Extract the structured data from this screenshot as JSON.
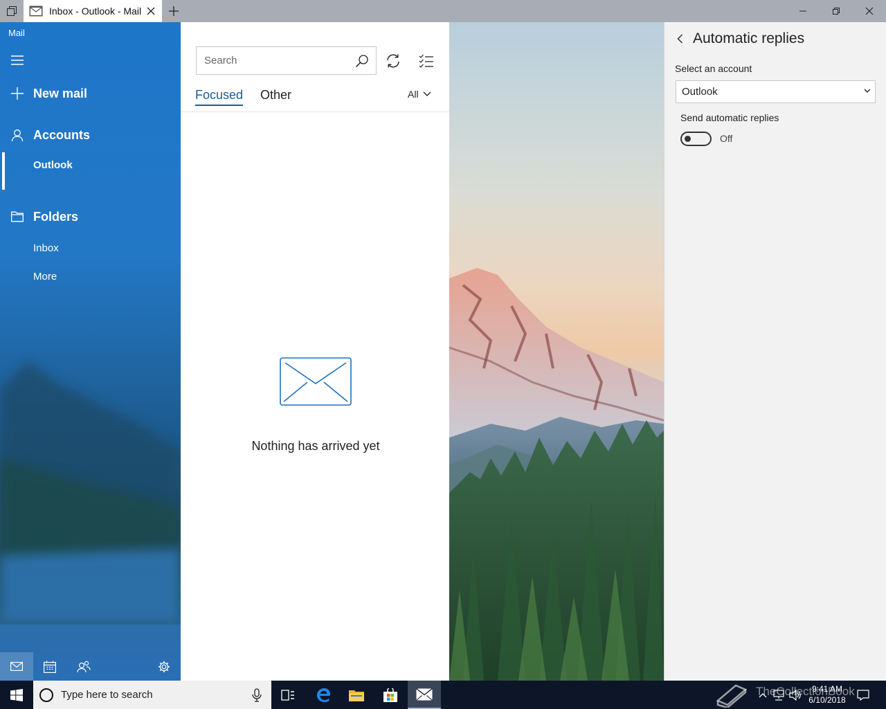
{
  "titlebar": {
    "tab_title": "Inbox - Outlook - Mail"
  },
  "nav": {
    "app_name": "Mail",
    "new_mail": "New mail",
    "accounts": "Accounts",
    "account_item": "Outlook",
    "folders": "Folders",
    "folder_items": [
      "Inbox",
      "More"
    ]
  },
  "list": {
    "search_placeholder": "Search",
    "tabs": {
      "focused": "Focused",
      "other": "Other"
    },
    "filter": "All",
    "empty_message": "Nothing has arrived yet"
  },
  "pane": {
    "title": "Automatic replies",
    "select_label": "Select an account",
    "selected_account": "Outlook",
    "toggle_label": "Send automatic replies",
    "toggle_state": "Off",
    "toggle_on": false
  },
  "taskbar": {
    "search_placeholder": "Type here to search",
    "time": "9:41 AM",
    "date": "6/10/2018",
    "watermark": "TheCollectionBook"
  },
  "colors": {
    "accent": "#1a5a9e",
    "nav_blue": "#1e76c9",
    "taskbar": "#0c1628",
    "pane_bg": "#f2f2f2"
  }
}
